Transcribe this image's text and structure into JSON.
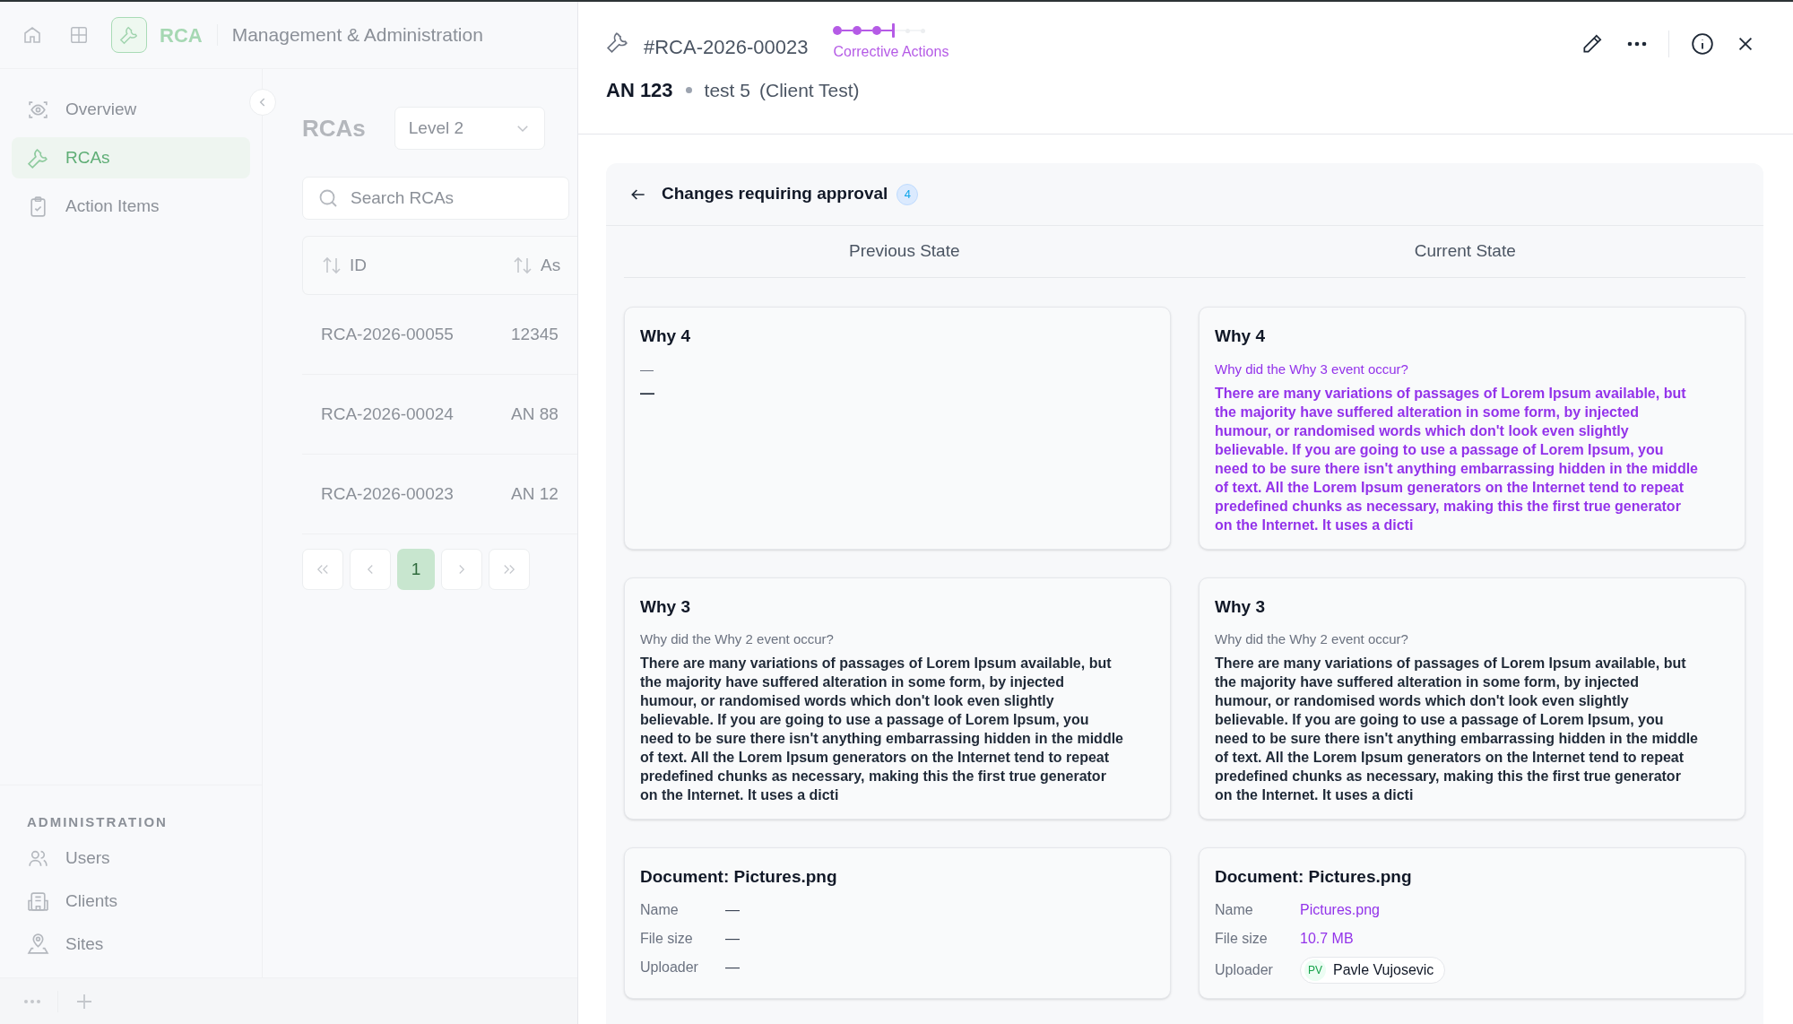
{
  "app_header": {
    "app_name": "RCA",
    "section": "Management & Administration"
  },
  "sidebar": {
    "items": [
      {
        "label": "Overview",
        "selected": false
      },
      {
        "label": "RCAs",
        "selected": true
      },
      {
        "label": "Action Items",
        "selected": false
      }
    ],
    "admin_heading": "ADMINISTRATION",
    "admin_items": [
      {
        "label": "Users",
        "selected": false
      },
      {
        "label": "Clients",
        "selected": false
      },
      {
        "label": "Sites",
        "selected": false
      }
    ]
  },
  "list": {
    "title": "RCAs",
    "level_filter": "Level 2",
    "search": {
      "placeholder": "Search RCAs"
    },
    "columns": [
      "ID",
      "As"
    ],
    "rows": [
      [
        "RCA-2026-00055",
        "12345"
      ],
      [
        "RCA-2026-00024",
        "AN 88"
      ],
      [
        "RCA-2026-00023",
        "AN 12"
      ]
    ],
    "pages": [
      {
        "label": "1",
        "selected": true
      }
    ]
  },
  "drawer": {
    "id": "#RCA-2026-00023",
    "steps": [
      {
        "done": true,
        "current": false
      },
      {
        "done": true,
        "current": false
      },
      {
        "done": true,
        "current": false
      },
      {
        "done": false,
        "current": true
      },
      {
        "done": false,
        "current": false
      },
      {
        "done": false,
        "current": false
      }
    ],
    "step_label": "Corrective Actions",
    "asset": "AN 123",
    "subtitle": "test 5",
    "client": "(Client Test)"
  },
  "changes": {
    "title": "Changes requiring approval",
    "count": "4",
    "columns": [
      "Previous State",
      "Current State"
    ],
    "rows": [
      {
        "previous": {
          "kind": "text",
          "title": "Why 4",
          "question": "—",
          "answer": "—",
          "changed": false
        },
        "current": {
          "kind": "text",
          "title": "Why 4",
          "question": "Why did the Why 3 event occur?",
          "answer": "There are many variations of passages of Lorem Ipsum available, but the majority have suffered alteration in some form, by injected humour, or randomised words which don't look even slightly believable. If you are going to use a passage of Lorem Ipsum, you need to be sure there isn't anything embarrassing hidden in the middle of text. All the Lorem Ipsum generators on the Internet tend to repeat predefined chunks as necessary, making this the first true generator on the Internet. It uses a dicti",
          "changed": true
        }
      },
      {
        "previous": {
          "kind": "text",
          "title": "Why 3",
          "question": "Why did the Why 2 event occur?",
          "answer": "There are many variations of passages of Lorem Ipsum available, but the majority have suffered alteration in some form, by injected humour, or randomised words which don't look even slightly believable. If you are going to use a passage of Lorem Ipsum, you need to be sure there isn't anything embarrassing hidden in the middle of text. All the Lorem Ipsum generators on the Internet tend to repeat predefined chunks as necessary, making this the first true generator on the Internet. It uses a dicti",
          "changed": false
        },
        "current": {
          "kind": "text",
          "title": "Why 3",
          "question": "Why did the Why 2 event occur?",
          "answer": "There are many variations of passages of Lorem Ipsum available, but the majority have suffered alteration in some form, by injected humour, or randomised words which don't look even slightly believable. If you are going to use a passage of Lorem Ipsum, you need to be sure there isn't anything embarrassing hidden in the middle of text. All the Lorem Ipsum generators on the Internet tend to repeat predefined chunks as necessary, making this the first true generator on the Internet. It uses a dicti",
          "changed": false
        }
      },
      {
        "previous": {
          "kind": "document",
          "title": "Document: Pictures.png",
          "changed": false,
          "fields": [
            {
              "label": "Name",
              "value": "—"
            },
            {
              "label": "File size",
              "value": "—"
            },
            {
              "label": "Uploader",
              "value": "—"
            }
          ]
        },
        "current": {
          "kind": "document",
          "title": "Document: Pictures.png",
          "changed": true,
          "fields": [
            {
              "label": "Name",
              "value": "Pictures.png"
            },
            {
              "label": "File size",
              "value": "10.7 MB"
            },
            {
              "label": "Uploader",
              "initials": "PV",
              "value": "Pavle Vujosevic"
            }
          ]
        }
      }
    ]
  }
}
